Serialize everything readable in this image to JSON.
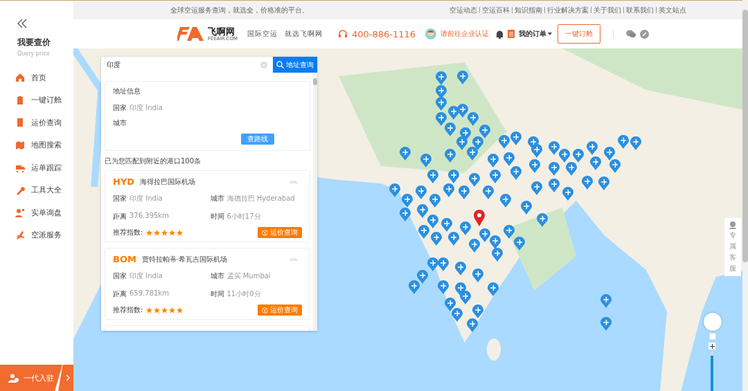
{
  "top_bar": {
    "slogan": "全球空运服务查询，就选全，价格准的平台。",
    "links": [
      "空运动态",
      "空运百科",
      "知识指南",
      "行业解决方案",
      "关于我们",
      "联系我们",
      "英文站点"
    ]
  },
  "sidebar": {
    "title": "我要查价",
    "subtitle": "Query price",
    "items": [
      {
        "label": "首页"
      },
      {
        "label": "一键订舱"
      },
      {
        "label": "运价查询"
      },
      {
        "label": "地图搜索"
      },
      {
        "label": "运单跟踪"
      },
      {
        "label": "工具大全"
      },
      {
        "label": "实单询盘"
      },
      {
        "label": "空派服务"
      }
    ],
    "join_button": "一代入驻"
  },
  "header": {
    "logo": "飞啊网",
    "logo_sub": "FEEAIR.COM",
    "tagline": [
      "国际空运",
      "就选飞啊网"
    ],
    "phone": "400-886-1116",
    "certify": "请前往企业认证",
    "orders": "我的订单",
    "book_button": "一键订舱"
  },
  "search": {
    "value": "印度",
    "button": "地址查询"
  },
  "address_info": {
    "title": "地址信息",
    "country_label": "国家",
    "country": "印度  India",
    "city_label": "城市",
    "route_button": "查路线"
  },
  "match_text": "已为您匹配到附近的港口100条",
  "airports": [
    {
      "code": "HYD",
      "name": "海得拉巴国际机场",
      "country_label": "国家",
      "country": "印度 India",
      "city_label": "城市",
      "city": "海德拉巴 Hyderabad",
      "distance_label": "距离",
      "distance": "376.395km",
      "time_label": "时间",
      "time": "6小时17分",
      "rating_label": "推荐指数:",
      "stars": 5,
      "button": "运价查询"
    },
    {
      "code": "BOM",
      "name": "贾特拉帕蒂·希瓦吉国际机场",
      "country_label": "国家",
      "country": "印度 India",
      "city_label": "城市",
      "city": "孟买 Mumbai",
      "distance_label": "距离",
      "distance": "659.781km",
      "time_label": "时间",
      "time": "11小时0分",
      "rating_label": "推荐指数:",
      "stars": 5,
      "button": "运价查询"
    }
  ],
  "service_widget": [
    "专",
    "属",
    "客",
    "服"
  ],
  "map_zoom": {
    "level": 0.9
  }
}
